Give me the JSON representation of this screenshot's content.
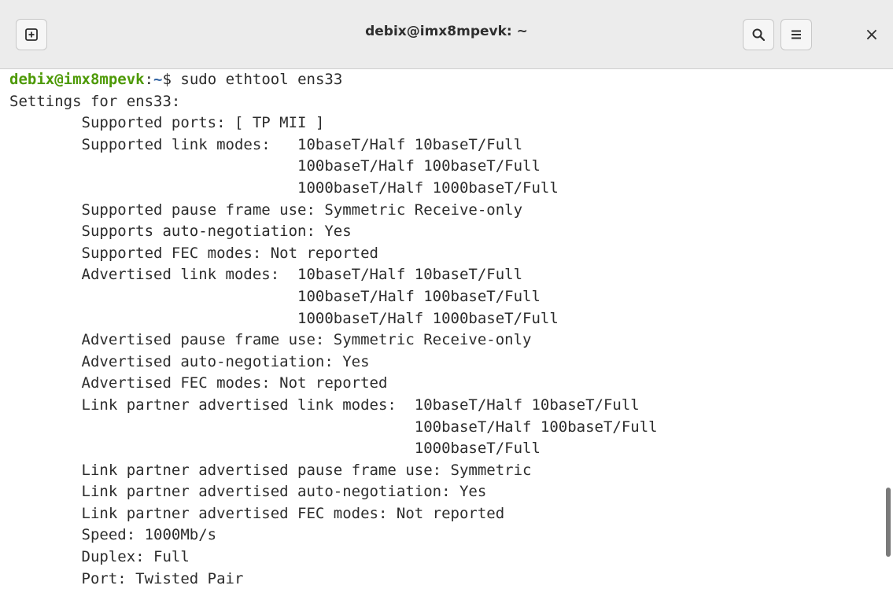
{
  "window": {
    "title": "debix@imx8mpevk: ~",
    "close_glyph": "×"
  },
  "icons": {
    "new_tab": "new-tab-icon",
    "search": "search-icon",
    "menu": "hamburger-menu-icon",
    "close": "close-icon"
  },
  "colors": {
    "prompt_user": "#4e9a06",
    "prompt_path": "#3465a4",
    "text": "#2c2c2c"
  },
  "terminal": {
    "prompt": {
      "user_host": "debix@imx8mpevk",
      "separator": ":",
      "path": "~",
      "symbol": "$ ",
      "command": "sudo ethtool ens33"
    },
    "lines": [
      "Settings for ens33:",
      "        Supported ports: [ TP MII ]",
      "        Supported link modes:   10baseT/Half 10baseT/Full",
      "                                100baseT/Half 100baseT/Full",
      "                                1000baseT/Half 1000baseT/Full",
      "        Supported pause frame use: Symmetric Receive-only",
      "        Supports auto-negotiation: Yes",
      "        Supported FEC modes: Not reported",
      "        Advertised link modes:  10baseT/Half 10baseT/Full",
      "                                100baseT/Half 100baseT/Full",
      "                                1000baseT/Half 1000baseT/Full",
      "        Advertised pause frame use: Symmetric Receive-only",
      "        Advertised auto-negotiation: Yes",
      "        Advertised FEC modes: Not reported",
      "        Link partner advertised link modes:  10baseT/Half 10baseT/Full",
      "                                             100baseT/Half 100baseT/Full",
      "                                             1000baseT/Full",
      "        Link partner advertised pause frame use: Symmetric",
      "        Link partner advertised auto-negotiation: Yes",
      "        Link partner advertised FEC modes: Not reported",
      "        Speed: 1000Mb/s",
      "        Duplex: Full",
      "        Port: Twisted Pair"
    ]
  }
}
